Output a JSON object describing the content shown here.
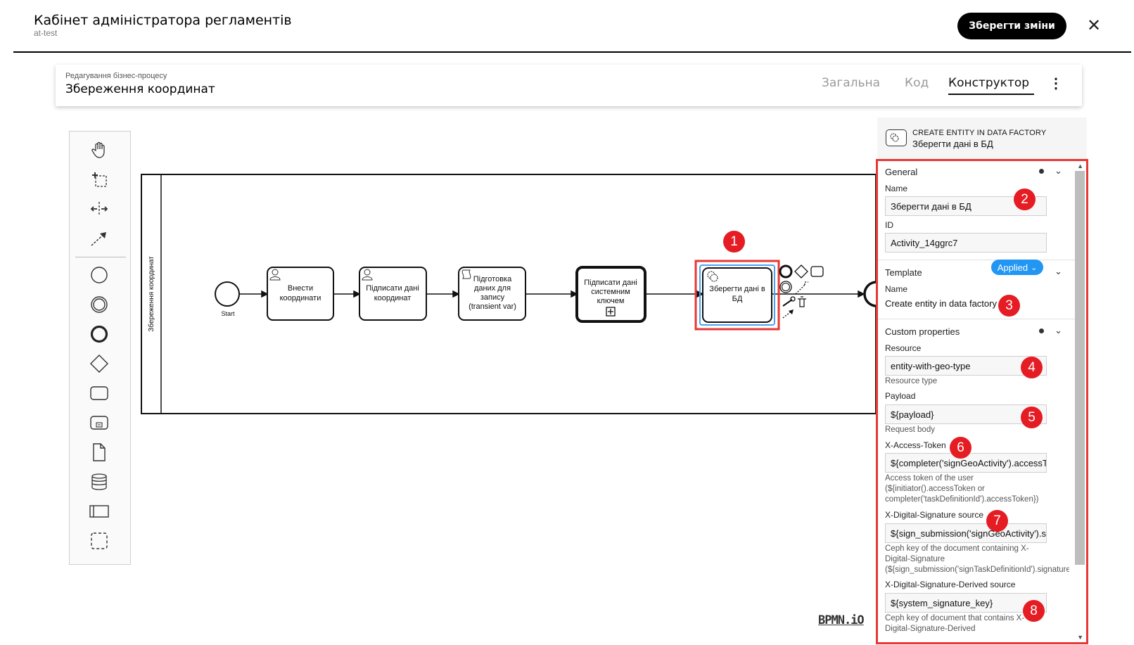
{
  "header": {
    "title": "Кабінет адміністратора регламентів",
    "subtitle": "at-test",
    "save_label": "Зберегти зміни",
    "close_icon": "close-icon"
  },
  "process": {
    "caption": "Редагування бізнес-процесу",
    "name": "Збереження координат",
    "tabs": [
      {
        "label": "Загальна",
        "active": false
      },
      {
        "label": "Код",
        "active": false
      },
      {
        "label": "Конструктор",
        "active": true
      }
    ],
    "more_icon": "more-vertical-icon"
  },
  "palette": {
    "tools": [
      "hand-tool-icon",
      "lasso-tool-icon",
      "space-tool-icon",
      "connect-tool-icon",
      "start-event-icon",
      "intermediate-event-icon",
      "end-event-icon",
      "gateway-icon",
      "task-icon",
      "subprocess-icon",
      "data-object-icon",
      "data-store-icon",
      "pool-icon",
      "group-icon"
    ]
  },
  "diagram": {
    "pool_label": "Збереження координат",
    "start_label": "Start",
    "tasks": [
      {
        "label_lines": [
          "Внести",
          "координати"
        ],
        "type": "user"
      },
      {
        "label_lines": [
          "Підписати дані",
          "координат"
        ],
        "type": "user"
      },
      {
        "label_lines": [
          "Підготовка",
          "даних для",
          "запису",
          "(transient var)"
        ],
        "type": "script"
      },
      {
        "label_lines": [
          "Підписати дані",
          "системним",
          "ключем"
        ],
        "type": "call-activity"
      },
      {
        "label_lines": [
          "Зберегти дані в",
          "БД"
        ],
        "type": "service",
        "selected": true
      }
    ]
  },
  "properties": {
    "element_type": "CREATE ENTITY IN DATA FACTORY",
    "element_name": "Зберегти дані в БД",
    "general": {
      "title": "General",
      "name_label": "Name",
      "name_value": "Зберегти дані в БД",
      "id_label": "ID",
      "id_value": "Activity_14ggrc7"
    },
    "template": {
      "title": "Template",
      "badge": "Applied",
      "name_label": "Name",
      "name_value": "Create entity in data factory"
    },
    "custom": {
      "title": "Custom properties",
      "resource_label": "Resource",
      "resource_value": "entity-with-geo-type",
      "resource_desc": "Resource type",
      "payload_label": "Payload",
      "payload_value": "${payload}",
      "payload_desc": "Request body",
      "token_label": "X-Access-Token",
      "token_value": "${completer('signGeoActivity').accessToken}",
      "token_desc": "Access token of the user\n(${initiator().accessToken or\ncompleter('taskDefinitionId').accessToken})",
      "sig_label": "X-Digital-Signature source",
      "sig_value": "${sign_submission('signGeoActivity').signatureDocumentId}",
      "sig_desc": "Ceph key of the document containing X-\nDigital-Signature\n(${sign_submission('signTaskDefinitionId').signatureDocumentId})",
      "sig_derived_label": "X-Digital-Signature-Derived source",
      "sig_derived_value": "${system_signature_key}",
      "sig_derived_desc": "Ceph key of document that contains X-\nDigital-Signature-Derived"
    }
  },
  "markers": [
    "1",
    "2",
    "3",
    "4",
    "5",
    "6",
    "7",
    "8"
  ],
  "branding": "BPMN.iO",
  "colors": {
    "accent": "#2196f3",
    "marker": "#e51c23",
    "highlight_border": "#e53935"
  }
}
